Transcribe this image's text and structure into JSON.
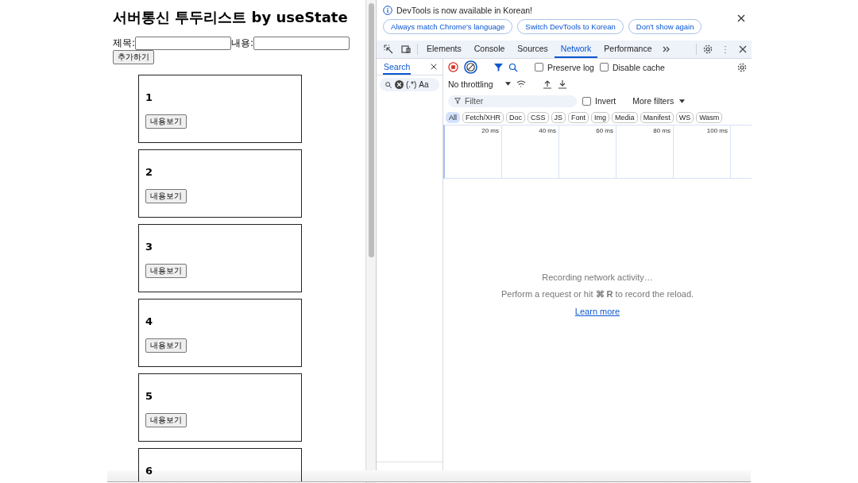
{
  "page": {
    "title": "서버통신 투두리스트 by useState",
    "fields": [
      {
        "label": "제목:"
      },
      {
        "label": "내용:"
      }
    ],
    "add_button": "추가하기",
    "todos": [
      {
        "title": "1",
        "button": "내용보기"
      },
      {
        "title": "2",
        "button": "내용보기"
      },
      {
        "title": "3",
        "button": "내용보기"
      },
      {
        "title": "4",
        "button": "내용보기"
      },
      {
        "title": "5",
        "button": "내용보기"
      },
      {
        "title": "6"
      }
    ]
  },
  "devtools": {
    "banner": {
      "message": "DevTools is now available in Korean!",
      "buttons": [
        "Always match Chrome's language",
        "Switch DevTools to Korean",
        "Don't show again"
      ]
    },
    "tabs": [
      {
        "label": "Elements",
        "selected": false
      },
      {
        "label": "Console",
        "selected": false
      },
      {
        "label": "Sources",
        "selected": false
      },
      {
        "label": "Network",
        "selected": true
      },
      {
        "label": "Performance",
        "selected": false
      }
    ],
    "sidebar": {
      "tab": "Search",
      "regex": "(.*)",
      "case": "Aa"
    },
    "network": {
      "checkboxes": [
        {
          "label": "Preserve log",
          "checked": false
        },
        {
          "label": "Disable cache",
          "checked": false
        }
      ],
      "throttling": "No throttling",
      "filter": {
        "placeholder": "Filter"
      },
      "invert": {
        "label": "Invert",
        "checked": false
      },
      "more_filters": "More filters",
      "types": [
        {
          "label": "All",
          "selected": true
        },
        {
          "label": "Fetch/XHR",
          "selected": false
        },
        {
          "label": "Doc",
          "selected": false
        },
        {
          "label": "CSS",
          "selected": false
        },
        {
          "label": "JS",
          "selected": false
        },
        {
          "label": "Font",
          "selected": false
        },
        {
          "label": "Img",
          "selected": false
        },
        {
          "label": "Media",
          "selected": false
        },
        {
          "label": "Manifest",
          "selected": false
        },
        {
          "label": "WS",
          "selected": false
        },
        {
          "label": "Wasm",
          "selected": false
        }
      ],
      "ticks": [
        "20 ms",
        "40 ms",
        "60 ms",
        "80 ms",
        "100 ms"
      ],
      "status": "Recording network activity…",
      "hint": "Perform a request or hit **⌘ R** to record the reload.",
      "link": "Learn more"
    }
  }
}
